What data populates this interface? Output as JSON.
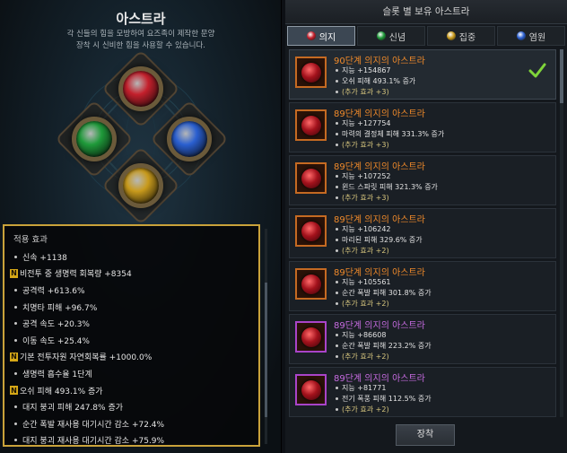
{
  "left": {
    "title": "아스트라",
    "desc_line1": "각 신들의 힘을 모방하여 요즈족이 제작한 문양",
    "desc_line2": "장착 시 신비한 힘을 사용할 수 있습니다.",
    "emblem_slots": [
      {
        "name": "red",
        "color": "#c4202c"
      },
      {
        "name": "green",
        "color": "#1f9a3a"
      },
      {
        "name": "blue",
        "color": "#2a5fd0"
      },
      {
        "name": "yellow",
        "color": "#c89a1c"
      }
    ],
    "effects_title": "적용 효과",
    "effects": [
      {
        "text": "신속 +1138",
        "badge": ""
      },
      {
        "text": "비전투 중 생명력 회복량 +8354",
        "badge": "N"
      },
      {
        "text": "공격력 +613.6%",
        "badge": ""
      },
      {
        "text": "치명타 피해 +96.7%",
        "badge": ""
      },
      {
        "text": "공격 속도 +20.3%",
        "badge": ""
      },
      {
        "text": "이동 속도 +25.4%",
        "badge": ""
      },
      {
        "text": "기본 전투자원 자연회복률 +1000.0%",
        "badge": "N"
      },
      {
        "text": "생명력 흡수율 1단계",
        "badge": ""
      },
      {
        "text": "오쉬 피해 493.1% 증가",
        "badge": "N"
      },
      {
        "text": "대지 붕괴 피해 247.8% 증가",
        "badge": ""
      },
      {
        "text": "순간 폭발 재사용 대기시간 감소 +72.4%",
        "badge": ""
      },
      {
        "text": "대지 붕괴 재사용 대기시간 감소 +75.9%",
        "badge": ""
      }
    ]
  },
  "right": {
    "header": "슬롯 별 보유 아스트라",
    "tabs": [
      {
        "label": "의지",
        "color": "#c4202c"
      },
      {
        "label": "신념",
        "color": "#1f9a3a"
      },
      {
        "label": "집중",
        "color": "#c89a1c"
      },
      {
        "label": "염원",
        "color": "#2a5fd0"
      }
    ],
    "cards": [
      {
        "name": "90단계 의지의 아스트라",
        "name_color": "#f08a2a",
        "stat1": "지능 +154867",
        "stat2": "오쉬 피해 493.1% 증가",
        "extra": "(추가 효과 +3)",
        "equipped": true,
        "frame": "#c56a22"
      },
      {
        "name": "89단계 의지의 아스트라",
        "name_color": "#f08a2a",
        "stat1": "지능 +127754",
        "stat2": "마력의 결정체 피해 331.3% 증가",
        "extra": "(추가 효과 +3)",
        "equipped": false,
        "frame": "#c56a22"
      },
      {
        "name": "89단계 의지의 아스트라",
        "name_color": "#f08a2a",
        "stat1": "지능 +107252",
        "stat2": "윈드 스파릿 피해 321.3% 증가",
        "extra": "(추가 효과 +3)",
        "equipped": false,
        "frame": "#c56a22"
      },
      {
        "name": "89단계 의지의 아스트라",
        "name_color": "#f08a2a",
        "stat1": "지능 +106242",
        "stat2": "마리된 피해 329.6% 증가",
        "extra": "(추가 효과 +2)",
        "equipped": false,
        "frame": "#c56a22"
      },
      {
        "name": "89단계 의지의 아스트라",
        "name_color": "#f08a2a",
        "stat1": "지능 +105561",
        "stat2": "순간 폭발 피해 301.8% 증가",
        "extra": "(추가 효과 +2)",
        "equipped": false,
        "frame": "#c56a22"
      },
      {
        "name": "89단계 의지의 아스트라",
        "name_color": "#c66be0",
        "stat1": "지능 +86608",
        "stat2": "순간 폭발 피해 223.2% 증가",
        "extra": "(추가 효과 +2)",
        "equipped": false,
        "frame": "#a944c9"
      },
      {
        "name": "89단계 의지의 아스트라",
        "name_color": "#c66be0",
        "stat1": "지능 +81771",
        "stat2": "전기 폭풍 피해 112.5% 증가",
        "extra": "(추가 효과 +2)",
        "equipped": false,
        "frame": "#a944c9"
      }
    ],
    "equip_button": "장착"
  }
}
